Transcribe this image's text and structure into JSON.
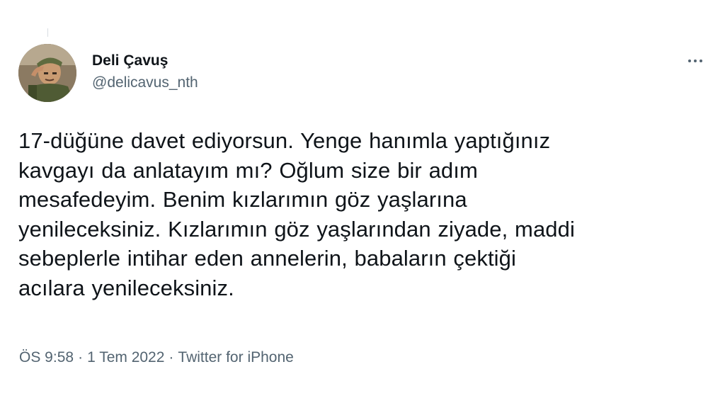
{
  "author": {
    "display_name": "Deli Çavuş",
    "handle": "@delicavus_nth",
    "avatar_icon": "saluting-soldier-avatar"
  },
  "more_icon": "ellipsis-icon",
  "tweet": {
    "lines": [
      "17-düğüne davet ediyorsun. Yenge hanımla yaptığınız",
      "kavgayı da anlatayım mı? Oğlum size bir adım",
      "mesafedeyim. Benim kızlarımın göz yaşlarına",
      "yenileceksiniz. Kızlarımın göz yaşlarından ziyade, maddi",
      "sebeplerle intihar eden annelerin, babaların çektiği",
      "acılara yenileceksiniz."
    ]
  },
  "meta": {
    "time": "ÖS 9:58",
    "separator": "·",
    "date": "1 Tem 2022",
    "source": "Twitter for iPhone"
  },
  "colors": {
    "text_primary": "#0f1419",
    "text_secondary": "#536471",
    "background": "#ffffff"
  }
}
